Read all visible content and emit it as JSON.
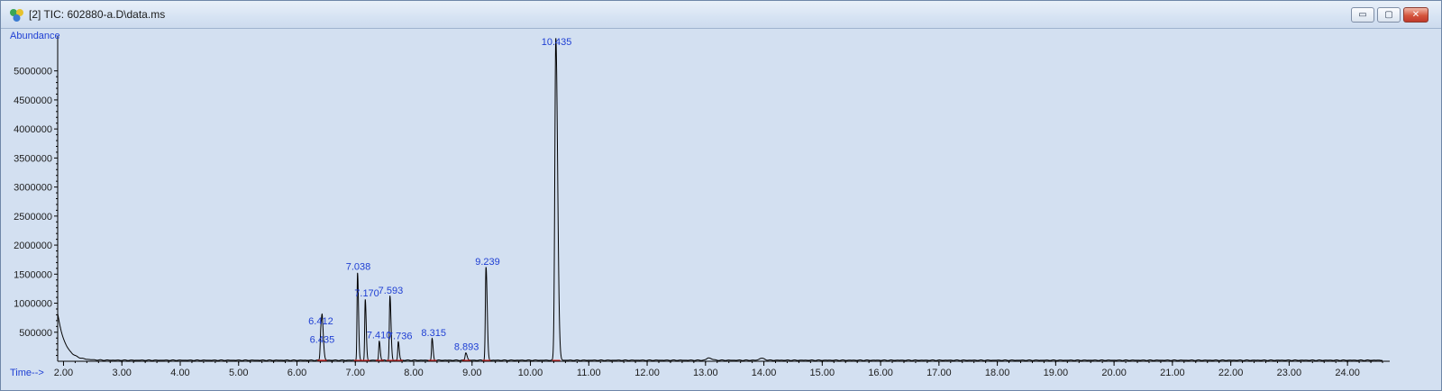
{
  "window": {
    "title": "[2] TIC: 602880-a.D\\data.ms",
    "icon": "chromatogram-app-icon",
    "buttons": {
      "minimize": "▭",
      "maximize": "▢",
      "close": "✕"
    }
  },
  "colors": {
    "plot_background": "#d3e0f1",
    "trace": "#000000",
    "labels": "#1f3fd3",
    "baseline_marks": "#cc2222"
  },
  "chart_data": {
    "type": "line",
    "ylabel": "Abundance",
    "xlabel": "Time-->",
    "xlim": [
      1.9,
      24.6
    ],
    "ylim": [
      0,
      5600000
    ],
    "grid": false,
    "x_ticks": [
      "2.00",
      "3.00",
      "4.00",
      "5.00",
      "6.00",
      "7.00",
      "8.00",
      "9.00",
      "10.00",
      "11.00",
      "12.00",
      "13.00",
      "14.00",
      "15.00",
      "16.00",
      "17.00",
      "18.00",
      "19.00",
      "20.00",
      "21.00",
      "22.00",
      "23.00",
      "24.00"
    ],
    "y_ticks": [
      "500000",
      "1000000",
      "1500000",
      "2000000",
      "2500000",
      "3000000",
      "3500000",
      "4000000",
      "4500000",
      "5000000"
    ],
    "baseline": 18000,
    "solvent_tail": {
      "start": 1.9,
      "start_value": 820000,
      "decay": 0.13
    },
    "peaks": [
      {
        "rt": 6.412,
        "height": 560000,
        "width": 0.012,
        "label": "6.412"
      },
      {
        "rt": 6.435,
        "height": 440000,
        "width": 0.012,
        "label": "6.435"
      },
      {
        "rt": 7.038,
        "height": 1500000,
        "width": 0.009,
        "label": "7.038"
      },
      {
        "rt": 7.17,
        "height": 1040000,
        "width": 0.009,
        "label": "7.170"
      },
      {
        "rt": 7.41,
        "height": 330000,
        "width": 0.009,
        "label": "7.410"
      },
      {
        "rt": 7.593,
        "height": 1100000,
        "width": 0.01,
        "label": "7.593"
      },
      {
        "rt": 7.736,
        "height": 320000,
        "width": 0.009,
        "label": "7.736"
      },
      {
        "rt": 8.315,
        "height": 370000,
        "width": 0.009,
        "label": "8.315"
      },
      {
        "rt": 8.893,
        "height": 130000,
        "width": 0.012,
        "label": "8.893"
      },
      {
        "rt": 9.239,
        "height": 1600000,
        "width": 0.011,
        "label": "9.239"
      },
      {
        "rt": 10.435,
        "height": 5550000,
        "width": 0.017,
        "label": "10.435"
      }
    ],
    "minor_peaks": [
      {
        "rt": 13.05,
        "height": 40000,
        "width": 0.03
      },
      {
        "rt": 13.95,
        "height": 35000,
        "width": 0.03
      }
    ]
  }
}
